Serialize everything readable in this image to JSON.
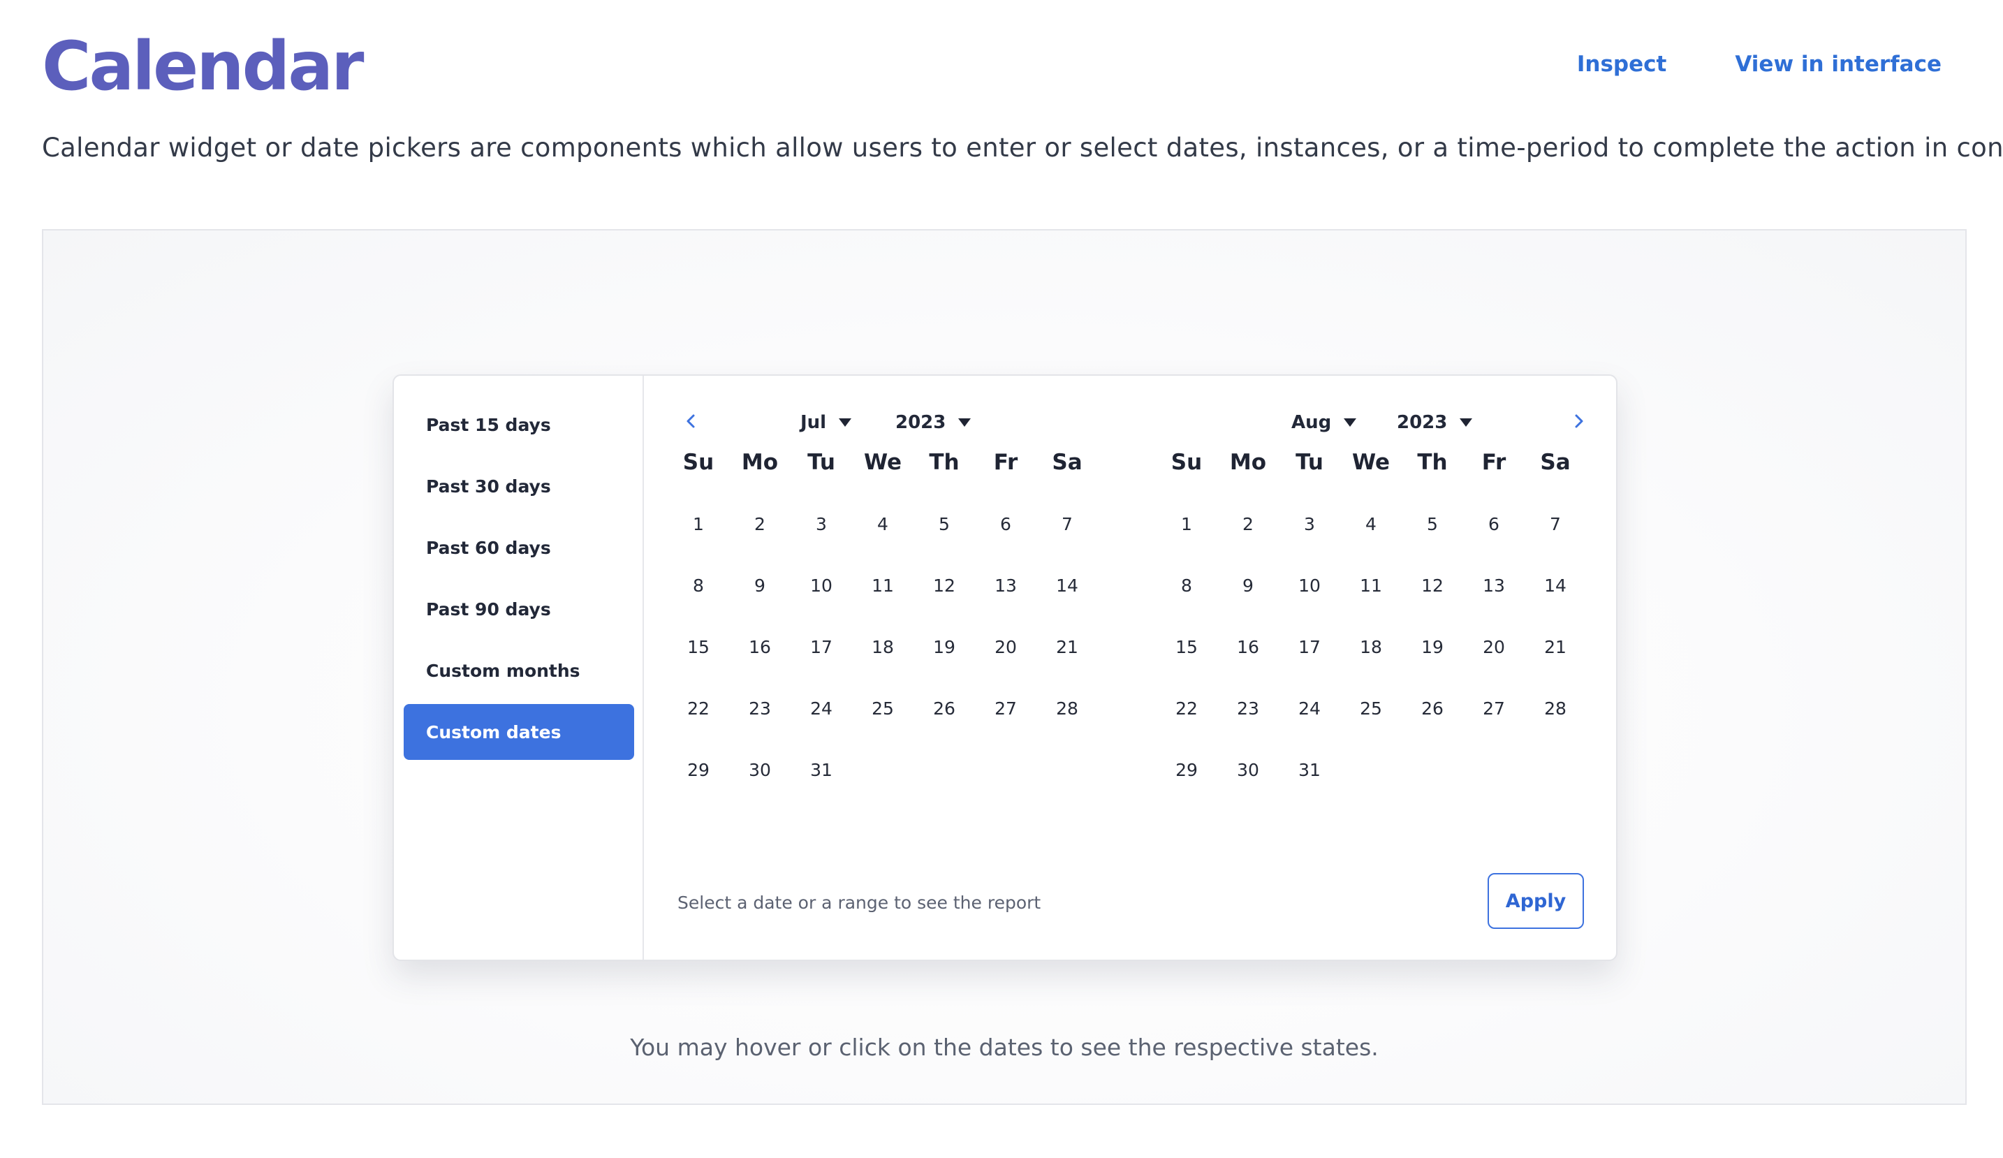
{
  "header": {
    "title": "Calendar",
    "links": [
      "Inspect",
      "View in interface"
    ],
    "description": "Calendar widget or date pickers are components which allow users to enter or select dates, instances, or a time-period to complete the action in context."
  },
  "presets": {
    "items": [
      "Past 15 days",
      "Past 30 days",
      "Past 60 days",
      "Past 90 days",
      "Custom months",
      "Custom dates"
    ],
    "active": "Custom dates"
  },
  "weekdays": [
    "Su",
    "Mo",
    "Tu",
    "We",
    "Th",
    "Fr",
    "Sa"
  ],
  "months": [
    {
      "month": "Jul",
      "year": "2023",
      "leading_blanks": 0,
      "days": 31
    },
    {
      "month": "Aug",
      "year": "2023",
      "leading_blanks": 0,
      "days": 31
    }
  ],
  "nav": {
    "prev_icon": "chevron-left-icon",
    "next_icon": "chevron-right-icon"
  },
  "footer": {
    "text": "Select a date or a range to see the report",
    "apply_label": "Apply"
  },
  "hint": "You may hover or click on the dates to see the respective states.",
  "colors": {
    "title": "#5c5fbc",
    "link": "#2f6fd6",
    "accent": "#3d72df"
  }
}
